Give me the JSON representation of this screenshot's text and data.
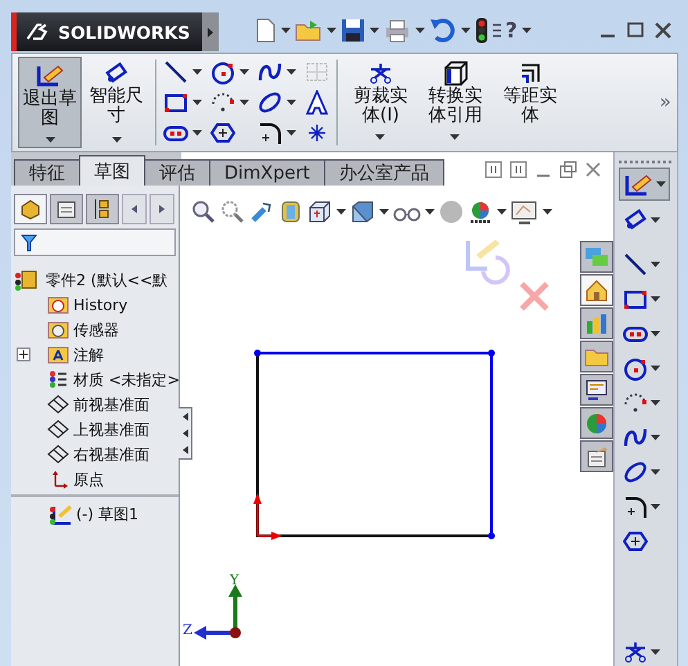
{
  "titlebar": {
    "logo": "SOLIDWORKS",
    "help": "?"
  },
  "command_manager": {
    "big_buttons": [
      {
        "label": "退出草图",
        "selected": true
      },
      {
        "label": "智能尺寸",
        "selected": false
      }
    ],
    "edit_buttons": [
      {
        "label": "剪裁实体(I)",
        "has_menu": true
      },
      {
        "label": "转换实体引用",
        "has_menu": true
      },
      {
        "label": "等距实体",
        "has_menu": false
      }
    ],
    "more": "»"
  },
  "tabs": [
    {
      "label": "特征",
      "selected": false
    },
    {
      "label": "草图",
      "selected": true
    },
    {
      "label": "评估",
      "selected": false
    },
    {
      "label": "DimXpert",
      "selected": false
    },
    {
      "label": "办公室产品",
      "selected": false
    }
  ],
  "task_pane_tabs": [
    {
      "selected": false
    },
    {
      "selected": true
    },
    {
      "selected": false
    },
    {
      "selected": false
    },
    {
      "selected": false
    },
    {
      "selected": false
    },
    {
      "selected": false
    }
  ],
  "manager_tabs": [
    {
      "selected": true
    },
    {
      "selected": false
    },
    {
      "selected": false
    }
  ],
  "feature_tree": {
    "root": {
      "label": "零件2  (默认<<默",
      "children": [
        {
          "label": "History",
          "kind": "history"
        },
        {
          "label": "传感器",
          "kind": "sensor"
        },
        {
          "label": "注解",
          "kind": "annotation",
          "expanded": false
        },
        {
          "label": "材质 <未指定>",
          "kind": "material"
        },
        {
          "label": "前视基准面",
          "kind": "plane"
        },
        {
          "label": "上视基准面",
          "kind": "plane"
        },
        {
          "label": "右视基准面",
          "kind": "plane"
        },
        {
          "label": "原点",
          "kind": "origin"
        },
        {
          "label": "(-) 草图1",
          "kind": "sketch"
        }
      ]
    }
  },
  "right_toolbar": [
    {
      "kind": "sketch",
      "selected": true
    },
    {
      "kind": "dimension",
      "selected": false
    },
    {
      "kind": "line",
      "selected": false
    },
    {
      "kind": "rect",
      "selected": false
    },
    {
      "kind": "slot",
      "selected": false
    },
    {
      "kind": "circle",
      "selected": false
    },
    {
      "kind": "arc",
      "selected": false
    },
    {
      "kind": "spline",
      "selected": false
    },
    {
      "kind": "ellipse",
      "selected": false
    },
    {
      "kind": "fillet",
      "selected": false
    },
    {
      "kind": "polygon",
      "selected": false
    },
    {
      "kind": "trim",
      "selected": false
    }
  ],
  "triad": {
    "y": "Y",
    "z": "Z"
  }
}
